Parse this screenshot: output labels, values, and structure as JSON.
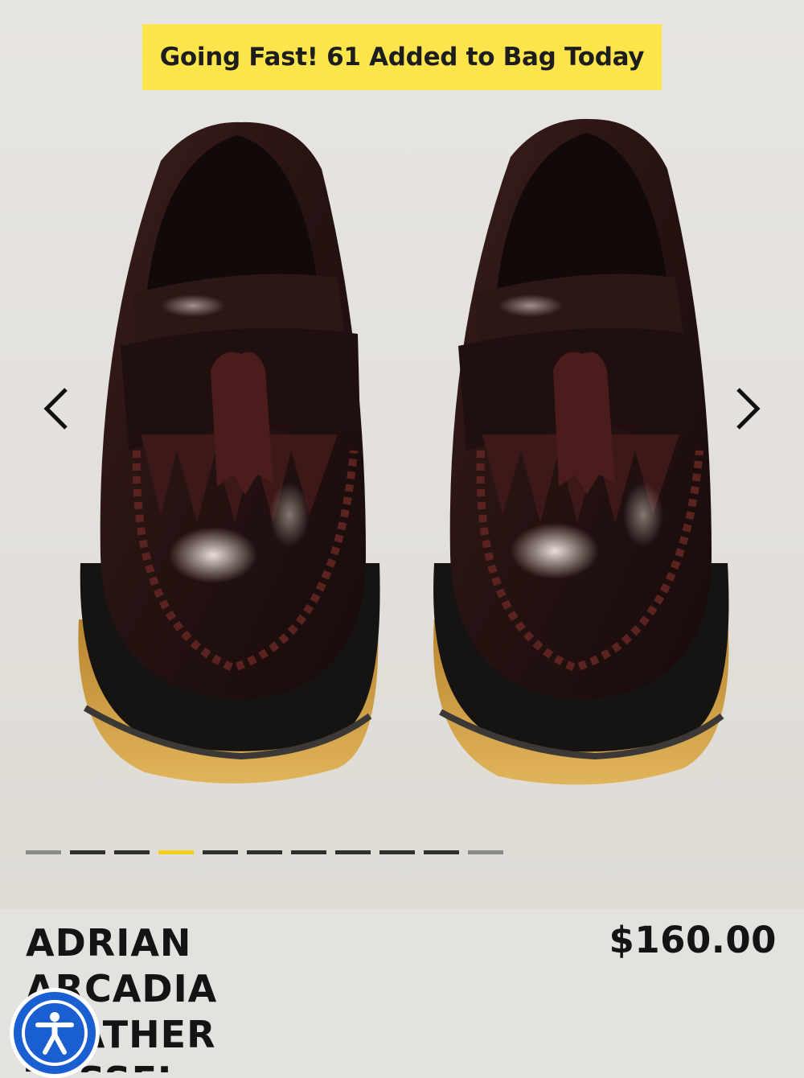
{
  "banner": {
    "text": "Going Fast! 61 Added to Bag Today"
  },
  "gallery": {
    "image_alt": "Adrian Arcadia leather tassel loafers, pair viewed from front",
    "slide_count": 11,
    "active_slide": 4
  },
  "product": {
    "title": "ADRIAN ARCADIA LEATHER TASSEL",
    "price": "$160.00"
  },
  "colors": {
    "badge": "#fbe54a",
    "active_dot": "#f2cf1a",
    "accessibility_button": "#1a5fd1"
  },
  "icons": {
    "prev": "chevron-left-icon",
    "next": "chevron-right-icon",
    "accessibility": "accessibility-person-icon"
  }
}
